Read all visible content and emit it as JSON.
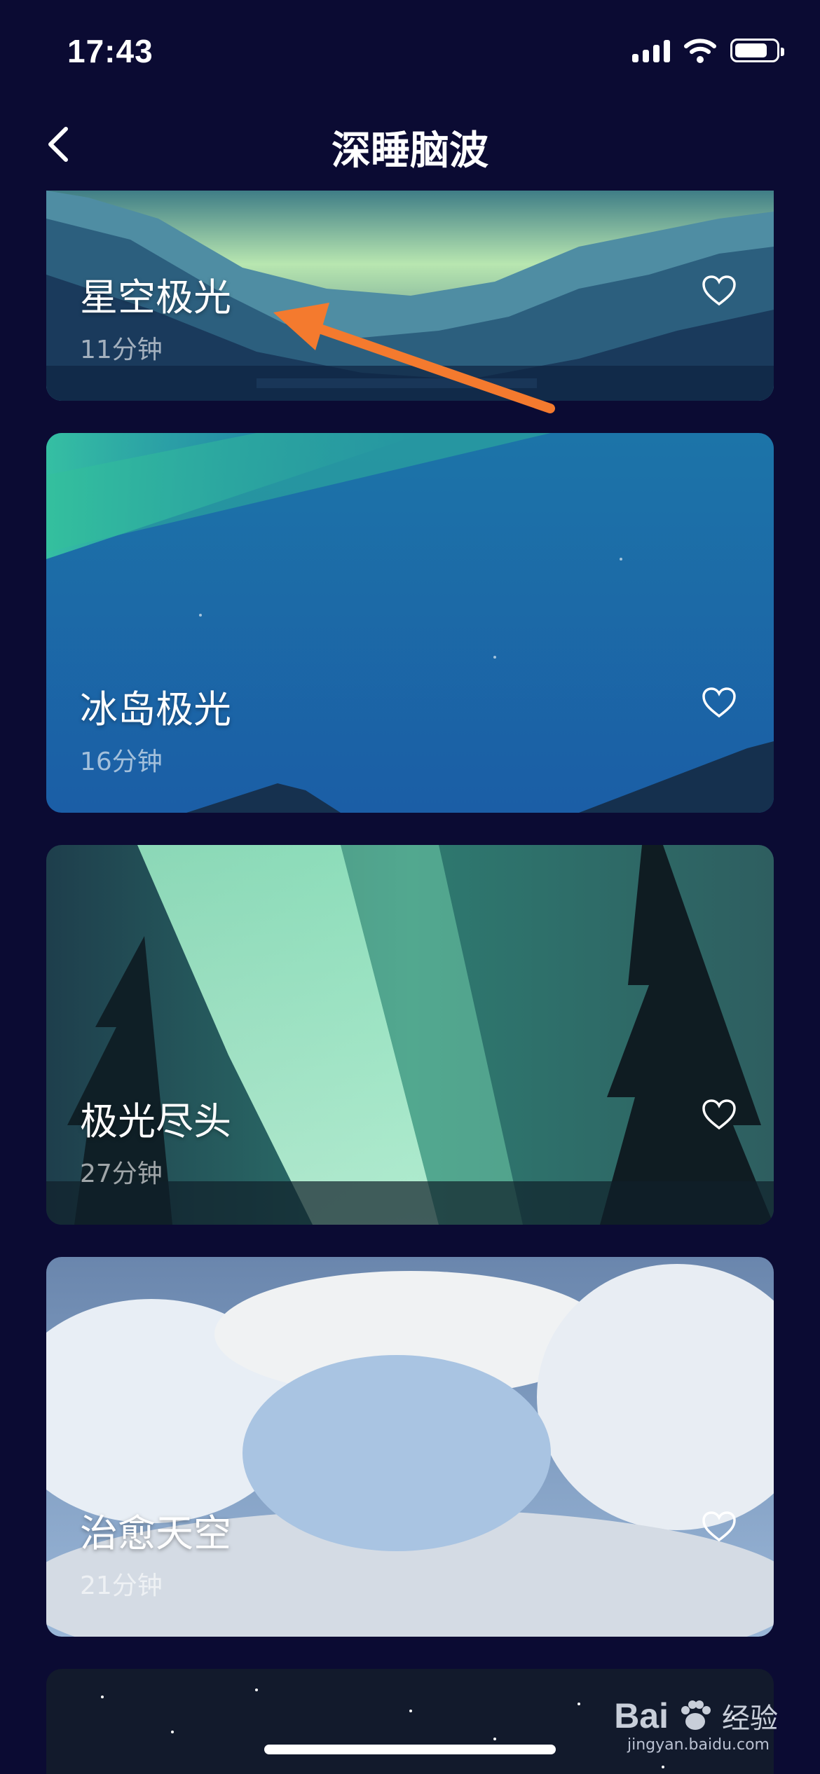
{
  "status_bar": {
    "time": "17:43"
  },
  "header": {
    "title": "深睡脑波"
  },
  "tracks": [
    {
      "name": "星空极光",
      "duration": "11分钟"
    },
    {
      "name": "冰岛极光",
      "duration": "16分钟"
    },
    {
      "name": "极光尽头",
      "duration": "27分钟"
    },
    {
      "name": "治愈天空",
      "duration": "21分钟"
    }
  ],
  "watermark": {
    "brand": "Bai",
    "brand_cn": "经验",
    "url": "jingyan.baidu.com"
  },
  "colors": {
    "background": "#0b0b33",
    "annotation_arrow": "#f47a2e"
  },
  "icons": [
    "back-icon",
    "heart-icon",
    "signal-icon",
    "wifi-icon",
    "battery-icon"
  ]
}
